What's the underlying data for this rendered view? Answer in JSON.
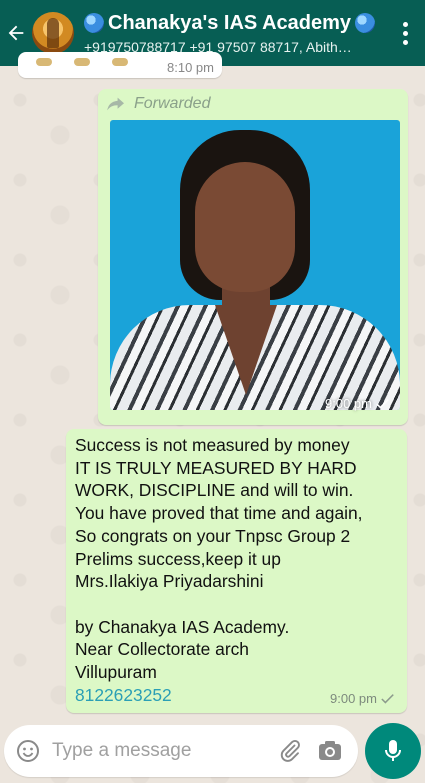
{
  "header": {
    "title": "Chanakya's IAS Academy",
    "subtitle": "+919750788717 +91 97507 88717, Abith…"
  },
  "previous_message": {
    "time": "8:10 pm"
  },
  "image_message": {
    "forwarded_label": "Forwarded",
    "time": "9:00 pm"
  },
  "text_message": {
    "lines": [
      "Success is not measured by money",
      "IT IS TRULY MEASURED BY HARD",
      "WORK, DISCIPLINE and will to win.",
      "You have proved that time and again,",
      "So congrats on your Tnpsc Group 2",
      "Prelims success,keep it up",
      "Mrs.Ilakiya Priyadarshini",
      "",
      "by Chanakya IAS Academy.",
      "Near Collectorate arch",
      "Villupuram"
    ],
    "phone_link": "8122623252",
    "time": "9:00 pm"
  },
  "input": {
    "placeholder": "Type a message"
  },
  "colors": {
    "header_bg": "#075e54",
    "outgoing_bubble": "#dcf8c6",
    "mic_button": "#00897b",
    "link": "#2a9fb5"
  },
  "icons": [
    "back-arrow-icon",
    "globe-icon",
    "more-vert-icon",
    "forward-icon",
    "single-check-icon",
    "emoji-icon",
    "attach-icon",
    "camera-icon",
    "mic-icon"
  ]
}
